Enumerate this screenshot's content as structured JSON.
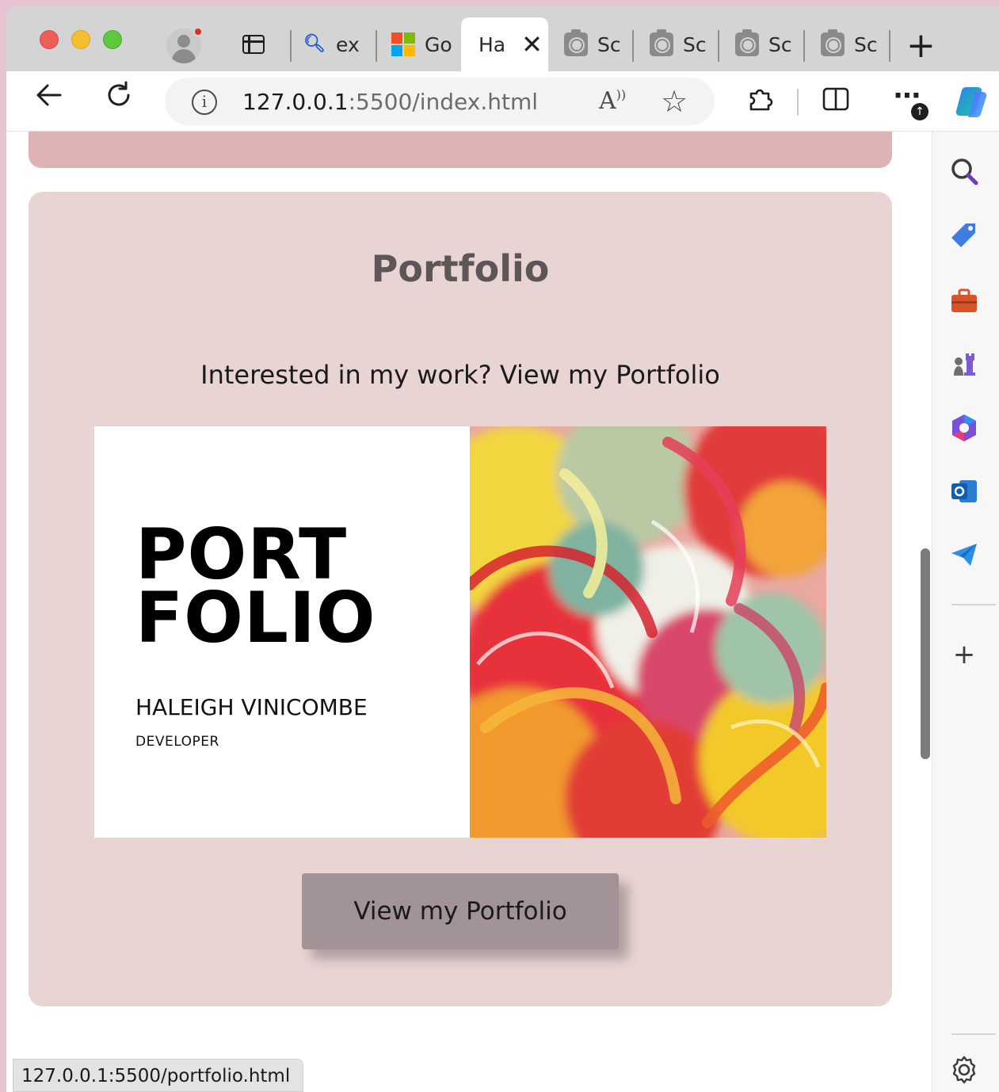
{
  "browser": {
    "tabs": [
      {
        "title": "ex",
        "icon": "search-icon"
      },
      {
        "title": "Go",
        "icon": "microsoft-logo-icon"
      },
      {
        "title": "Ha",
        "icon": "none",
        "active": true
      },
      {
        "title": "Sc",
        "icon": "camera-icon"
      },
      {
        "title": "Sc",
        "icon": "camera-icon"
      },
      {
        "title": "Sc",
        "icon": "camera-icon"
      },
      {
        "title": "Sc",
        "icon": "camera-icon"
      }
    ],
    "address": {
      "host": "127.0.0.1",
      "rest": ":5500/index.html"
    },
    "status_url": "127.0.0.1:5500/portfolio.html",
    "more_badge": "↑"
  },
  "page": {
    "section_title": "Portfolio",
    "section_subtitle": "Interested in my work? View my Portfolio",
    "cover": {
      "title_line1": "PORT",
      "title_line2": "FOLIO",
      "name": "HALEIGH VINICOMBE",
      "role": "DEVELOPER"
    },
    "button_label": "View my Portfolio"
  },
  "colors": {
    "section_bg": "#e8d4d3",
    "prev_section_bg": "#dfb3b5",
    "button_bg": "#a29397",
    "title_color": "#5e5557"
  }
}
